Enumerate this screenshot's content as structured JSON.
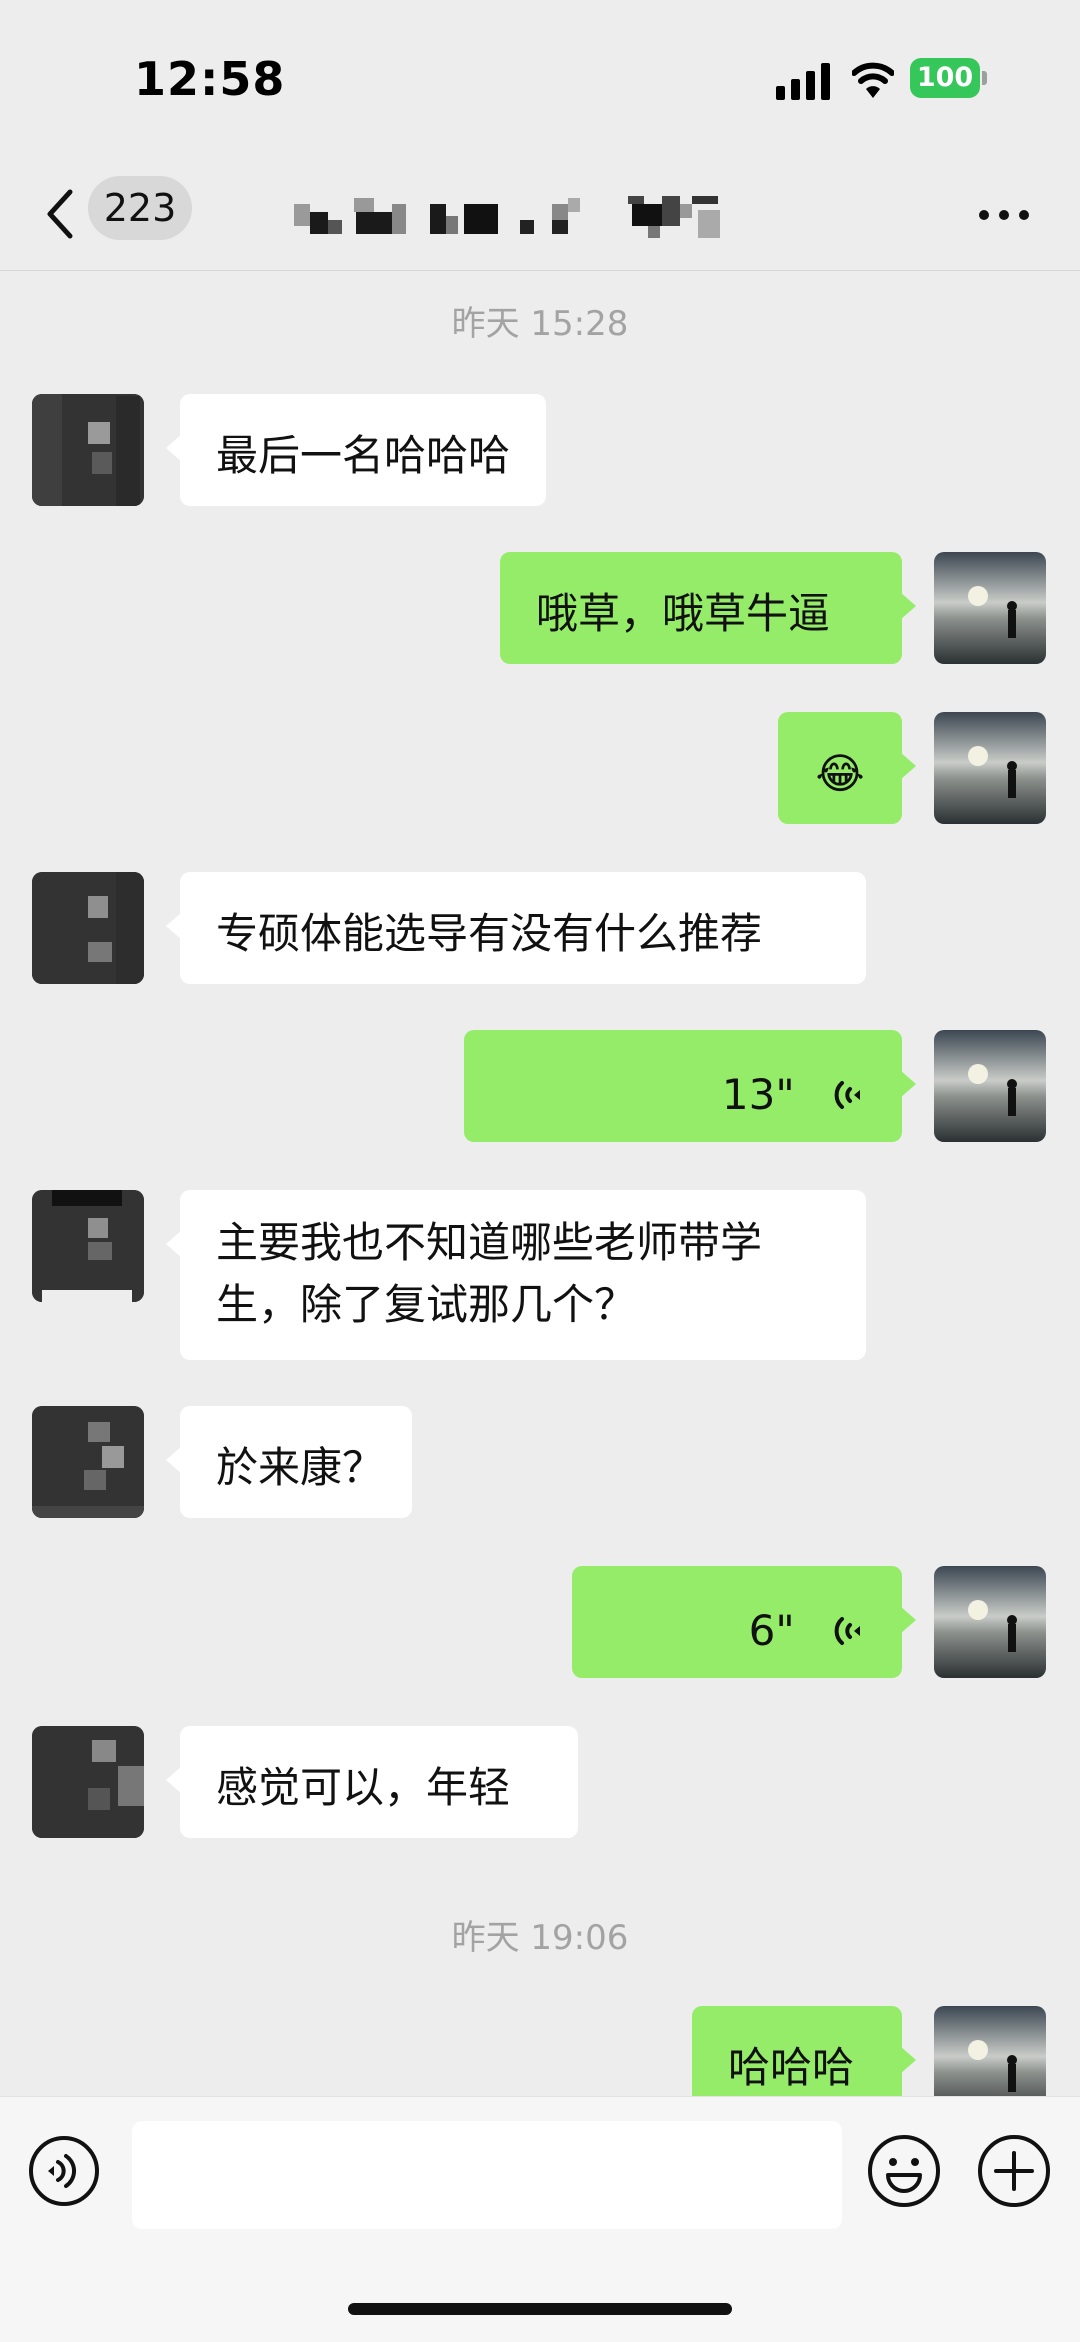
{
  "status_bar": {
    "time": "12:58",
    "battery": "100",
    "icons": [
      "signal-icon",
      "wifi-icon",
      "battery-icon"
    ]
  },
  "nav": {
    "unread_count": "223",
    "icons": [
      "chevron-left-icon",
      "more-icon"
    ]
  },
  "timestamps": [
    "昨天 15:28",
    "昨天 19:06"
  ],
  "messages": [
    {
      "side": "left",
      "text": "最后一名哈哈哈"
    },
    {
      "side": "right",
      "text": "哦草，哦草牛逼"
    },
    {
      "side": "right",
      "text": "😂"
    },
    {
      "side": "left",
      "text": "专硕体能选导有没有什么推荐"
    },
    {
      "side": "right",
      "text": "13\"",
      "kind": "voice"
    },
    {
      "side": "left",
      "text": "主要我也不知道哪些老师带学生，除了复试那几个？"
    },
    {
      "side": "left",
      "text": "於来康？"
    },
    {
      "side": "right",
      "text": "6\"",
      "kind": "voice"
    },
    {
      "side": "left",
      "text": "感觉可以，年轻"
    },
    {
      "side": "right",
      "text": "哈哈哈"
    }
  ],
  "colors": {
    "outgoing_bubble": "#95ec69",
    "incoming_bubble": "#ffffff",
    "background": "#ededed",
    "battery": "#35c759"
  },
  "input_bar": {
    "value": "",
    "icons": [
      "voice-input-icon",
      "emoji-icon",
      "plus-icon"
    ]
  }
}
